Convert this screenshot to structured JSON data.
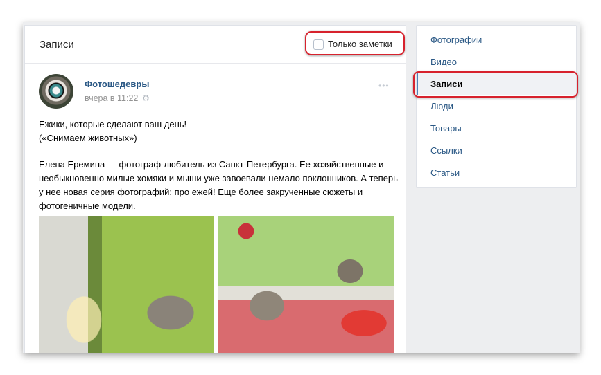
{
  "wall": {
    "title": "Записи",
    "filter_label": "Только заметки"
  },
  "post": {
    "author": "Фотошедевры",
    "time": "вчера в 11:22",
    "text_line1": "Ежики, которые сделают ваш день!",
    "text_line2": "(«Снимаем животных»)",
    "text_para": "Елена Еремина — фотограф-любитель из Санкт-Петербурга. Ее хозяйственные и необыкновенно милые хомяки и мыши уже завоевали немало поклонников. А теперь у нее новая серия фотографий: про ежей! Еще более закрученные сюжеты и фотогеничные модели.",
    "more_glyph": "•••",
    "gear_glyph": "⚙"
  },
  "sidebar": {
    "items": [
      {
        "label": "Фотографии"
      },
      {
        "label": "Видео"
      },
      {
        "label": "Записи"
      },
      {
        "label": "Люди"
      },
      {
        "label": "Товары"
      },
      {
        "label": "Ссылки"
      },
      {
        "label": "Статьи"
      }
    ],
    "active_index": 2
  },
  "colors": {
    "link": "#2a5885",
    "highlight": "#d7222d",
    "background": "#edeef0"
  }
}
